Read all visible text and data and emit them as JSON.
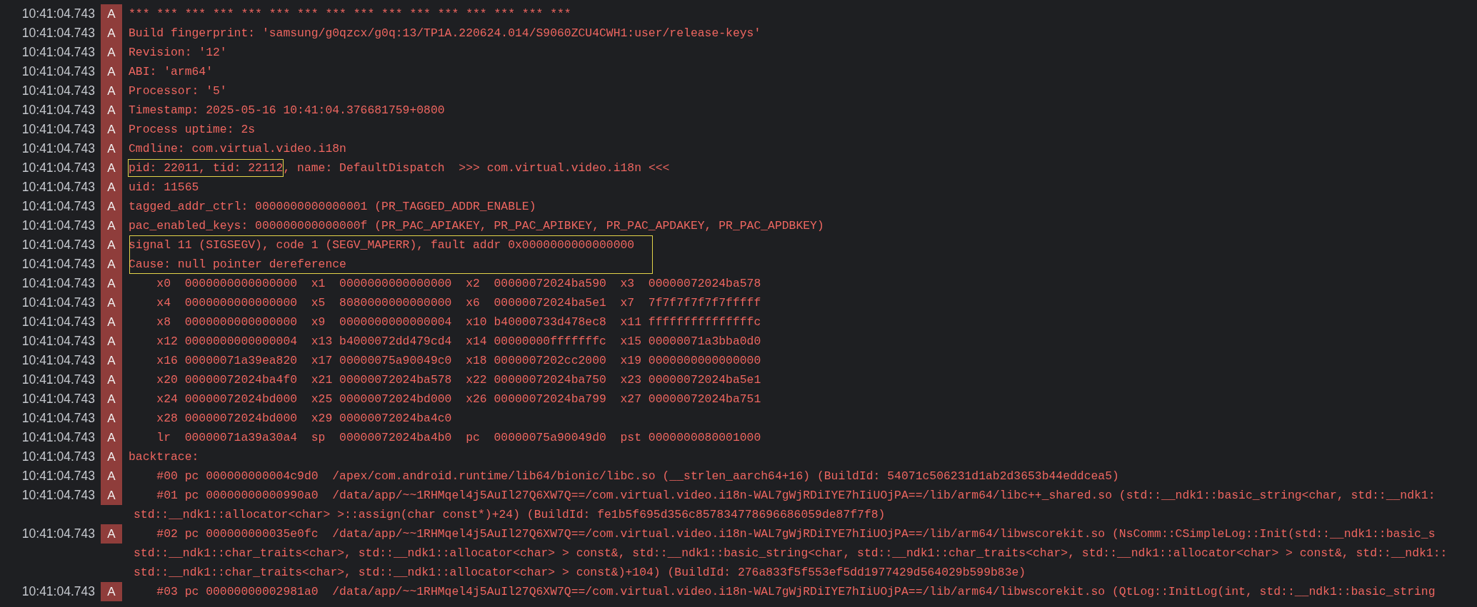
{
  "entries": [
    {
      "time": "10:41:04.743",
      "level": "A",
      "lines": [
        [
          {
            "text": "*** *** *** *** *** *** *** *** *** *** *** *** *** *** *** ***",
            "boxed": false
          }
        ]
      ],
      "boxed": false
    },
    {
      "time": "10:41:04.743",
      "level": "A",
      "lines": [
        [
          {
            "text": "Build fingerprint: 'samsung/g0qzcx/g0q:13/TP1A.220624.014/S9060ZCU4CWH1:user/release-keys'",
            "boxed": false
          }
        ]
      ],
      "boxed": false
    },
    {
      "time": "10:41:04.743",
      "level": "A",
      "lines": [
        [
          {
            "text": "Revision: '12'",
            "boxed": false
          }
        ]
      ],
      "boxed": false
    },
    {
      "time": "10:41:04.743",
      "level": "A",
      "lines": [
        [
          {
            "text": "ABI: 'arm64'",
            "boxed": false
          }
        ]
      ],
      "boxed": false
    },
    {
      "time": "10:41:04.743",
      "level": "A",
      "lines": [
        [
          {
            "text": "Processor: '5'",
            "boxed": false
          }
        ]
      ],
      "boxed": false
    },
    {
      "time": "10:41:04.743",
      "level": "A",
      "lines": [
        [
          {
            "text": "Timestamp: 2025-05-16 10:41:04.376681759+0800",
            "boxed": false
          }
        ]
      ],
      "boxed": false
    },
    {
      "time": "10:41:04.743",
      "level": "A",
      "lines": [
        [
          {
            "text": "Process uptime: 2s",
            "boxed": false
          }
        ]
      ],
      "boxed": false
    },
    {
      "time": "10:41:04.743",
      "level": "A",
      "lines": [
        [
          {
            "text": "Cmdline: com.virtual.video.i18n",
            "boxed": false
          }
        ]
      ],
      "boxed": false
    },
    {
      "time": "10:41:04.743",
      "level": "A",
      "lines": [
        [
          {
            "text": "pid: 22011, tid: 22112",
            "boxed": true
          },
          {
            "text": ", name: DefaultDispatch  >>> com.virtual.video.i18n <<<",
            "boxed": false
          }
        ]
      ],
      "boxed": false
    },
    {
      "time": "10:41:04.743",
      "level": "A",
      "lines": [
        [
          {
            "text": "uid: 11565",
            "boxed": false
          }
        ]
      ],
      "boxed": false
    },
    {
      "time": "10:41:04.743",
      "level": "A",
      "lines": [
        [
          {
            "text": "tagged_addr_ctrl: 0000000000000001 (PR_TAGGED_ADDR_ENABLE)",
            "boxed": false
          }
        ]
      ],
      "boxed": false
    },
    {
      "time": "10:41:04.743",
      "level": "A",
      "lines": [
        [
          {
            "text": "pac_enabled_keys: 000000000000000f (PR_PAC_APIAKEY, PR_PAC_APIBKEY, PR_PAC_APDAKEY, PR_PAC_APDBKEY)",
            "boxed": false
          }
        ]
      ],
      "boxed": false
    },
    {
      "time": "10:41:04.743",
      "level": "A",
      "lines": [
        [
          {
            "text": "signal 11 (SIGSEGV), code 1 (SEGV_MAPERR), fault addr 0x0000000000000000",
            "boxed": false
          }
        ]
      ],
      "boxed": true
    },
    {
      "time": "10:41:04.743",
      "level": "A",
      "lines": [
        [
          {
            "text": "Cause: null pointer dereference",
            "boxed": false
          }
        ]
      ],
      "boxed": true
    },
    {
      "time": "10:41:04.743",
      "level": "A",
      "lines": [
        [
          {
            "text": "    x0  0000000000000000  x1  0000000000000000  x2  00000072024ba590  x3  00000072024ba578",
            "boxed": false
          }
        ]
      ],
      "boxed": false
    },
    {
      "time": "10:41:04.743",
      "level": "A",
      "lines": [
        [
          {
            "text": "    x4  0000000000000000  x5  8080000000000000  x6  00000072024ba5e1  x7  7f7f7f7f7f7fffff",
            "boxed": false
          }
        ]
      ],
      "boxed": false
    },
    {
      "time": "10:41:04.743",
      "level": "A",
      "lines": [
        [
          {
            "text": "    x8  0000000000000000  x9  0000000000000004  x10 b40000733d478ec8  x11 fffffffffffffffc",
            "boxed": false
          }
        ]
      ],
      "boxed": false
    },
    {
      "time": "10:41:04.743",
      "level": "A",
      "lines": [
        [
          {
            "text": "    x12 0000000000000004  x13 b4000072dd479cd4  x14 00000000fffffffc  x15 00000071a3bba0d0",
            "boxed": false
          }
        ]
      ],
      "boxed": false
    },
    {
      "time": "10:41:04.743",
      "level": "A",
      "lines": [
        [
          {
            "text": "    x16 00000071a39ea820  x17 00000075a90049c0  x18 0000007202cc2000  x19 0000000000000000",
            "boxed": false
          }
        ]
      ],
      "boxed": false
    },
    {
      "time": "10:41:04.743",
      "level": "A",
      "lines": [
        [
          {
            "text": "    x20 00000072024ba4f0  x21 00000072024ba578  x22 00000072024ba750  x23 00000072024ba5e1",
            "boxed": false
          }
        ]
      ],
      "boxed": false
    },
    {
      "time": "10:41:04.743",
      "level": "A",
      "lines": [
        [
          {
            "text": "    x24 00000072024bd000  x25 00000072024bd000  x26 00000072024ba799  x27 00000072024ba751",
            "boxed": false
          }
        ]
      ],
      "boxed": false
    },
    {
      "time": "10:41:04.743",
      "level": "A",
      "lines": [
        [
          {
            "text": "    x28 00000072024bd000  x29 00000072024ba4c0",
            "boxed": false
          }
        ]
      ],
      "boxed": false
    },
    {
      "time": "10:41:04.743",
      "level": "A",
      "lines": [
        [
          {
            "text": "    lr  00000071a39a30a4  sp  00000072024ba4b0  pc  00000075a90049d0  pst 0000000080001000",
            "boxed": false
          }
        ]
      ],
      "boxed": false
    },
    {
      "time": "10:41:04.743",
      "level": "A",
      "lines": [
        [
          {
            "text": "backtrace:",
            "boxed": false
          }
        ]
      ],
      "boxed": false
    },
    {
      "time": "10:41:04.743",
      "level": "A",
      "lines": [
        [
          {
            "text": "    #00 pc 000000000004c9d0  /apex/com.android.runtime/lib64/bionic/libc.so (__strlen_aarch64+16) (BuildId: 54071c506231d1ab2d3653b44eddcea5)",
            "boxed": false
          }
        ]
      ],
      "boxed": false
    },
    {
      "time": "10:41:04.743",
      "level": "A",
      "lines": [
        [
          {
            "text": "    #01 pc 00000000000990a0  /data/app/~~1RHMqel4j5AuIl27Q6XW7Q==/com.virtual.video.i18n-WAL7gWjRDiIYE7hIiUOjPA==/lib/arm64/libc++_shared.so (std::__ndk1::basic_string<char, std::__ndk1:",
            "boxed": false
          }
        ],
        [
          {
            "text": "std::__ndk1::allocator<char> >::assign(char const*)+24) (BuildId: fe1b5f695d356c857834778696686059de87f7f8)",
            "boxed": false
          }
        ]
      ],
      "boxed": false
    },
    {
      "time": "10:41:04.743",
      "level": "A",
      "lines": [
        [
          {
            "text": "    #02 pc 000000000035e0fc  /data/app/~~1RHMqel4j5AuIl27Q6XW7Q==/com.virtual.video.i18n-WAL7gWjRDiIYE7hIiUOjPA==/lib/arm64/libwscorekit.so (NsComm::CSimpleLog::Init(std::__ndk1::basic_s",
            "boxed": false
          }
        ],
        [
          {
            "text": "std::__ndk1::char_traits<char>, std::__ndk1::allocator<char> > const&, std::__ndk1::basic_string<char, std::__ndk1::char_traits<char>, std::__ndk1::allocator<char> > const&, std::__ndk1::",
            "boxed": false
          }
        ],
        [
          {
            "text": "std::__ndk1::char_traits<char>, std::__ndk1::allocator<char> > const&)+104) (BuildId: 276a833f5f553ef5dd1977429d564029b599b83e)",
            "boxed": false
          }
        ]
      ],
      "boxed": false
    },
    {
      "time": "10:41:04.743",
      "level": "A",
      "lines": [
        [
          {
            "text": "    #03 pc 00000000002981a0  /data/app/~~1RHMqel4j5AuIl27Q6XW7Q==/com.virtual.video.i18n-WAL7gWjRDiIYE7hIiUOjPA==/lib/arm64/libwscorekit.so (QtLog::InitLog(int, std::__ndk1::basic_string",
            "boxed": false
          }
        ]
      ],
      "boxed": false
    }
  ]
}
